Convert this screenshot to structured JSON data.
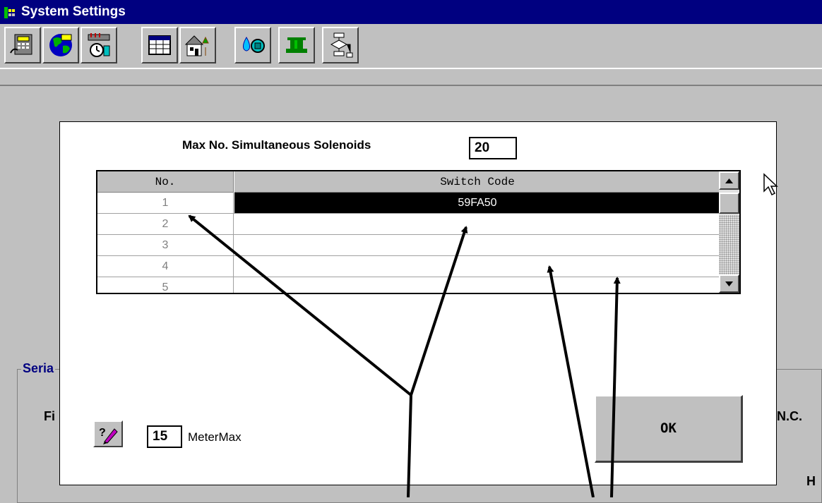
{
  "window": {
    "title": "System Settings"
  },
  "toolbar": {
    "buttons": [
      {
        "icon": "phone-device-icon"
      },
      {
        "icon": "globe-icon"
      },
      {
        "icon": "clock-gauge-icon"
      },
      {
        "icon": "spreadsheet-icon"
      },
      {
        "icon": "house-tree-icon"
      },
      {
        "icon": "water-drop-icon"
      },
      {
        "icon": "valve-icon"
      },
      {
        "icon": "flowchart-icon"
      }
    ]
  },
  "dialog": {
    "max_label": "Max No. Simultaneous Solenoids",
    "max_value": "20",
    "grid": {
      "headers": [
        "No.",
        "Switch Code"
      ],
      "rows": [
        {
          "no": "1",
          "code": "59FA50",
          "selected": true
        },
        {
          "no": "2",
          "code": ""
        },
        {
          "no": "3",
          "code": ""
        },
        {
          "no": "4",
          "code": ""
        },
        {
          "no": "5",
          "code": ""
        }
      ]
    },
    "meter_value": "15",
    "meter_label": "MeterMax",
    "ok_label": "OK"
  },
  "background": {
    "group_label": "Seria",
    "field_label": "Fi",
    "nc_label": "N.C.",
    "h_label": "H"
  },
  "colors": {
    "titlebar": "#000080",
    "face": "#c0c0c0",
    "selection": "#000000"
  }
}
